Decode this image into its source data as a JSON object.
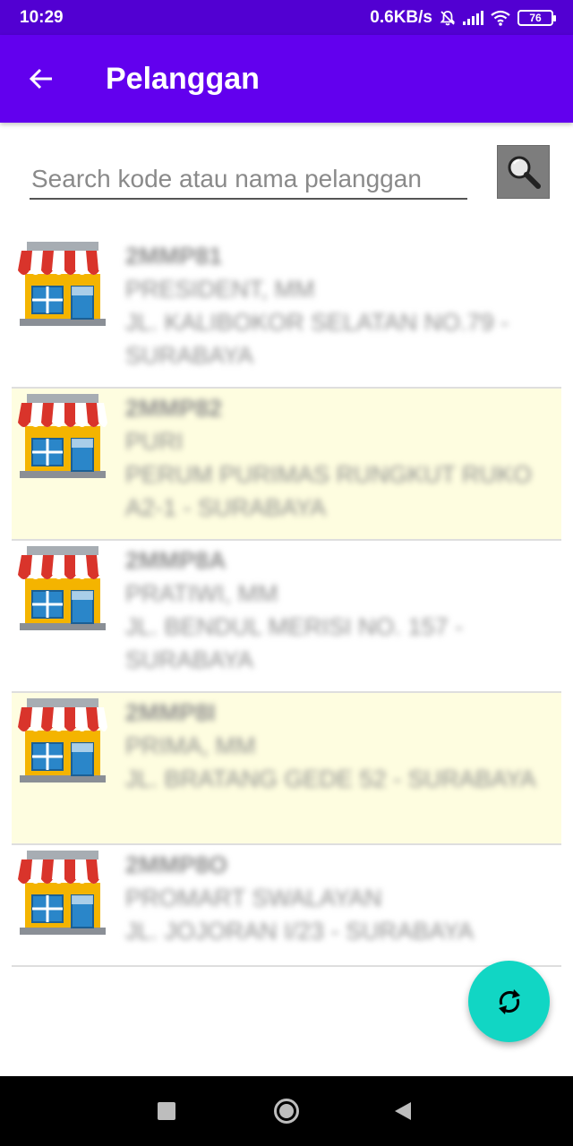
{
  "status_bar": {
    "time": "10:29",
    "network_speed": "0.6KB/s",
    "battery_level": "76",
    "icons": [
      "mute-bell-icon",
      "signal-icon",
      "wifi-icon",
      "battery-icon"
    ]
  },
  "app_bar": {
    "title": "Pelanggan",
    "background": "#6200ee",
    "back_icon": "arrow-left-icon"
  },
  "search": {
    "placeholder": "Search kode atau nama pelanggan",
    "value": "",
    "button_icon": "magnifier-icon"
  },
  "customers": [
    {
      "code": "2MMP81",
      "name": "PRESIDENT, MM",
      "address": "JL. KALIBOKOR SELATAN NO.79 - SURABAYA",
      "highlight": false
    },
    {
      "code": "2MMP82",
      "name": "PURI",
      "address": "PERUM PURIMAS RUNGKUT RUKO A2-1 - SURABAYA",
      "highlight": true
    },
    {
      "code": "2MMP8A",
      "name": "PRATIWI, MM",
      "address": "JL. BENDUL MERISI NO. 157 - SURABAYA",
      "highlight": false
    },
    {
      "code": "2MMP8I",
      "name": "PRIMA, MM",
      "address": "JL. BRATANG GEDE 52 - SURABAYA",
      "highlight": true
    },
    {
      "code": "2MMP8O",
      "name": "PROMART SWALAYAN",
      "address": "JL. JOJORAN I/23 - SURABAYA",
      "highlight": false
    }
  ],
  "fab": {
    "icon": "refresh-icon",
    "color": "#11d6c4"
  },
  "nav_bar": {
    "icons": [
      "recents-square-icon",
      "home-circle-icon",
      "back-triangle-icon"
    ]
  },
  "colors": {
    "row_highlight": "#fefde0",
    "divider": "#dedede"
  }
}
